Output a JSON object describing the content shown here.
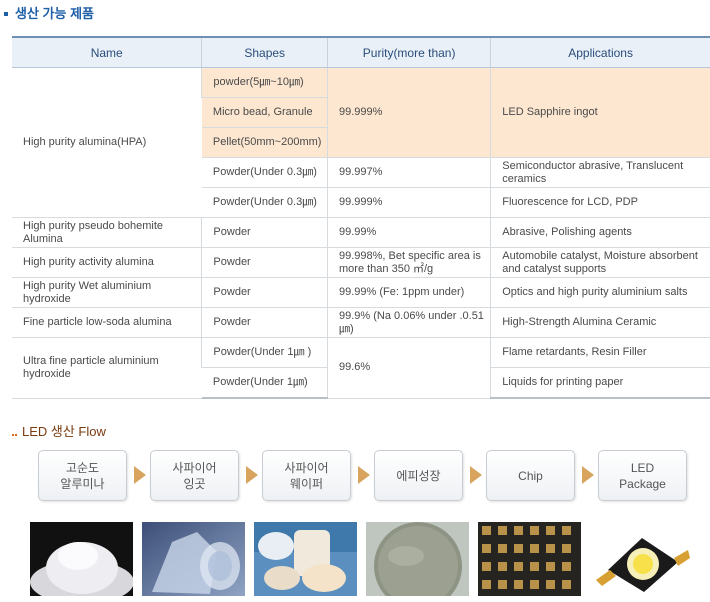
{
  "products_title": "생산 가능 제품",
  "table": {
    "headers": [
      "Name",
      "Shapes",
      "Purity(more than)",
      "Applications"
    ],
    "hpa": {
      "name": "High purity alumina(HPA)",
      "shape_1": "powder(5㎛~10㎛)",
      "shape_2": "Micro bead, Granule",
      "shape_3": "Pellet(50mm~200mm)",
      "purity_1": "99.999%",
      "app_1": "LED Sapphire ingot",
      "shape_4": "Powder(Under 0.3㎛)",
      "purity_4": "99.997%",
      "app_4": "Semiconductor abrasive, Translucent ceramics",
      "shape_5": "Powder(Under 0.3㎛)",
      "purity_5": "99.999%",
      "app_5": "Fluorescence for LCD, PDP"
    },
    "rows": [
      {
        "name": "High purity pseudo bohemite Alumina",
        "shape": "Powder",
        "purity": "99.99%",
        "app": "Abrasive, Polishing agents"
      },
      {
        "name": "High purity activity alumina",
        "shape": "Powder",
        "purity": "99.998%, Bet specific area is more than 350 ㎡/g",
        "app": "Automobile catalyst, Moisture absorbent and catalyst supports"
      },
      {
        "name": "High purity Wet aluminium hydroxide",
        "shape": "Powder",
        "purity": "99.99% (Fe: 1ppm under)",
        "app": "Optics and high purity aluminium salts"
      },
      {
        "name": "Fine particle low-soda alumina",
        "shape": "Powder",
        "purity": "99.9% (Na 0.06% under .0.51㎛)",
        "app": "High-Strength Alumina Ceramic"
      }
    ],
    "ultra": {
      "name": "Ultra fine particle aluminium hydroxide",
      "shape_1": "Powder(Under 1㎛ )",
      "shape_2": "Powder(Under 1㎛)",
      "purity": "99.6%",
      "app_1": "Flame retardants, Resin Filler",
      "app_2": "Liquids for printing paper"
    }
  },
  "flow_title": "LED 생산 Flow",
  "flow": [
    "고순도\n알루미나",
    "사파이어\n잉곳",
    "사파이어\n웨이퍼",
    "에피성장",
    "Chip",
    "LED\nPackage"
  ],
  "photos": [
    "alumina-powder",
    "sapphire-ingot",
    "sapphire-wafers",
    "epi-wafer",
    "led-chips",
    "led-package"
  ],
  "colors": {
    "title_blue": "#1f5fa8",
    "highlight": "#fde7d1",
    "arrow": "#d9a45e",
    "flow_title": "#7a3b10"
  }
}
